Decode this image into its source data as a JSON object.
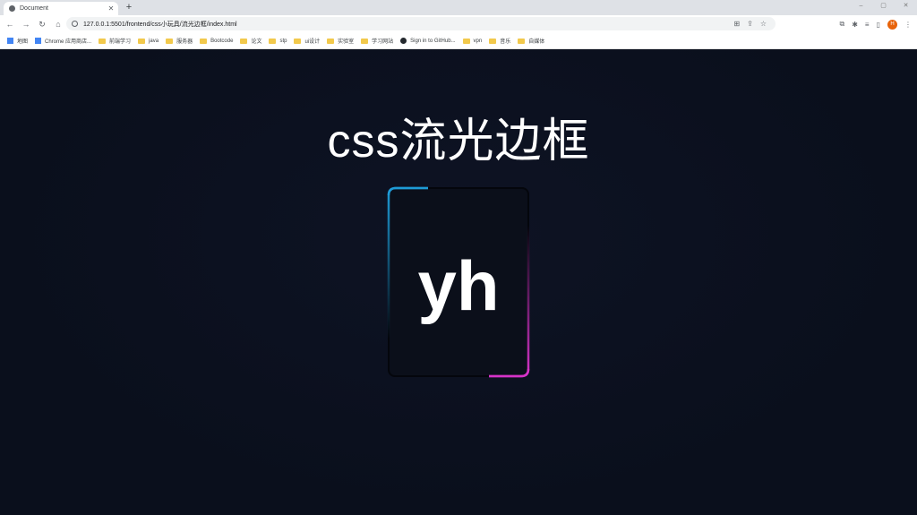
{
  "browser": {
    "tab_title": "Document",
    "new_tab": "+",
    "url": "127.0.0.1:5501/frontend/css小玩具/流光边框/index.html",
    "avatar_letter": "H",
    "bookmarks": [
      {
        "label": "地图",
        "icon": "app-icon"
      },
      {
        "label": "Chrome 应用商店...",
        "icon": "app-icon"
      },
      {
        "label": "前端学习",
        "icon": "folder-icon"
      },
      {
        "label": "java",
        "icon": "folder-icon"
      },
      {
        "label": "服务器",
        "icon": "folder-icon"
      },
      {
        "label": "Bootcode",
        "icon": "folder-icon"
      },
      {
        "label": "论文",
        "icon": "folder-icon"
      },
      {
        "label": "stp",
        "icon": "folder-icon"
      },
      {
        "label": "ui设计",
        "icon": "folder-icon"
      },
      {
        "label": "实验室",
        "icon": "folder-icon"
      },
      {
        "label": "学习网站",
        "icon": "folder-icon"
      },
      {
        "label": "Sign in to GitHub...",
        "icon": "github-icon"
      },
      {
        "label": "vpn",
        "icon": "folder-icon"
      },
      {
        "label": "音乐",
        "icon": "folder-icon"
      },
      {
        "label": "自媒体",
        "icon": "folder-icon"
      }
    ]
  },
  "page": {
    "heading": "css流光边框",
    "card_text": "yh"
  },
  "colors": {
    "background": "#0a0f1c",
    "glow_start": "#1e9bd7",
    "glow_end": "#d633c8"
  }
}
